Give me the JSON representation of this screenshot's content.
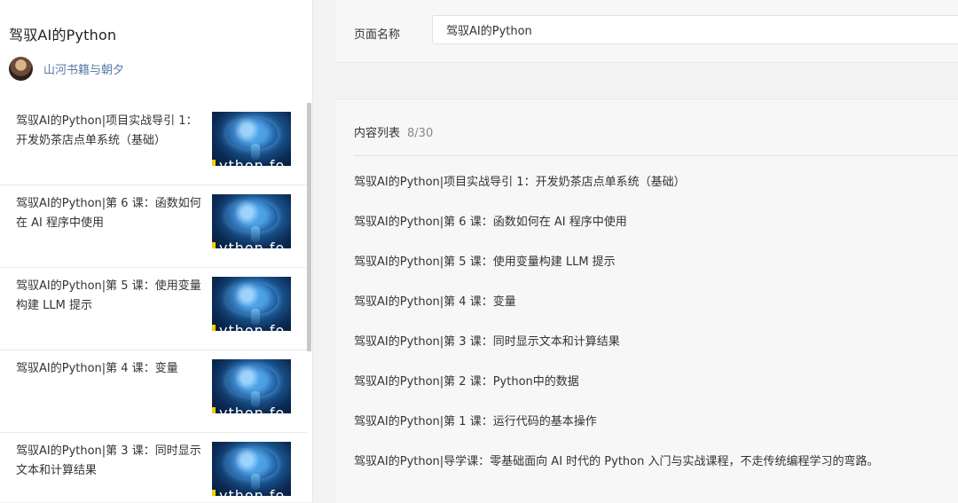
{
  "preview": {
    "title": "驾驭AI的Python",
    "author": "山河书籍与朝夕",
    "items": [
      {
        "title": "驾驭AI的Python|项目实战导引 1：开发奶茶店点单系统（基础）",
        "thumb_text": "ython fo"
      },
      {
        "title": "驾驭AI的Python|第 6 课：函数如何在 AI 程序中使用",
        "thumb_text": "ython fo"
      },
      {
        "title": "驾驭AI的Python|第 5 课：使用变量构建 LLM 提示",
        "thumb_text": "ython fo"
      },
      {
        "title": "驾驭AI的Python|第 4 课：变量",
        "thumb_text": "ython fo"
      },
      {
        "title": "驾驭AI的Python|第 3 课：同时显示文本和计算结果",
        "thumb_text": "ython fo"
      }
    ]
  },
  "form": {
    "page_name_label": "页面名称",
    "page_name_value": "驾驭AI的Python"
  },
  "content_list": {
    "label": "内容列表",
    "count": "8/30",
    "items": [
      "驾驭AI的Python|项目实战导引 1：开发奶茶店点单系统（基础）",
      "驾驭AI的Python|第 6 课：函数如何在 AI 程序中使用",
      "驾驭AI的Python|第 5 课：使用变量构建 LLM 提示",
      "驾驭AI的Python|第 4 课：变量",
      "驾驭AI的Python|第 3 课：同时显示文本和计算结果",
      "驾驭AI的Python|第 2 课：Python中的数据",
      "驾驭AI的Python|第 1 课：运行代码的基本操作",
      "驾驭AI的Python|导学课：零基础面向 AI 时代的 Python 入门与实战课程，不走传统编程学习的弯路。"
    ]
  },
  "colors": {
    "author_link": "#5a7aa8",
    "background": "#f3f3f3"
  }
}
